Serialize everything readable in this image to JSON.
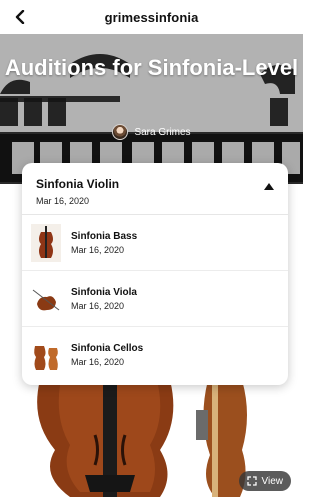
{
  "header": {
    "title": "grimessinfonia"
  },
  "hero": {
    "title": "Auditions for Sinfonia-Level",
    "author": "Sara Grimes"
  },
  "dropdown": {
    "selected": {
      "title": "Sinfonia Violin",
      "date": "Mar 16, 2020"
    },
    "items": [
      {
        "title": "Sinfonia Bass",
        "date": "Mar 16, 2020",
        "icon": "double-bass-icon"
      },
      {
        "title": "Sinfonia Viola",
        "date": "Mar 16, 2020",
        "icon": "viola-icon"
      },
      {
        "title": "Sinfonia Cellos",
        "date": "Mar 16, 2020",
        "icon": "cello-icon"
      }
    ]
  },
  "view_button": {
    "label": "View"
  }
}
